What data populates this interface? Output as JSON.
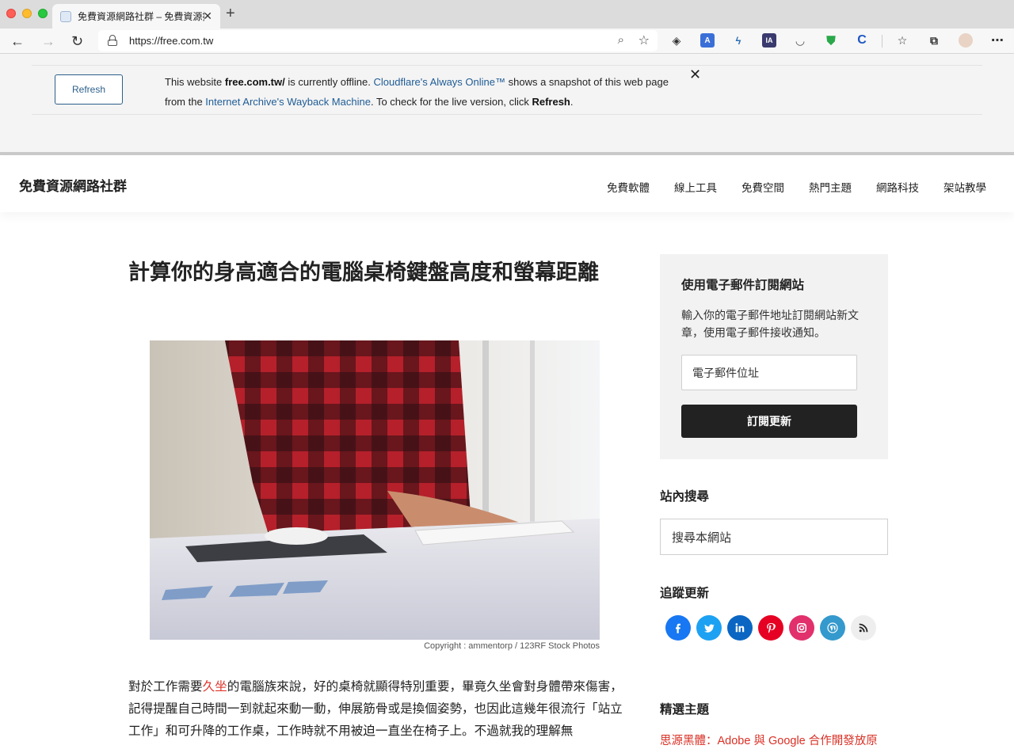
{
  "browser": {
    "tab_title": "免費資源網路社群 – 免費資源指南",
    "url": "https://free.com.tw"
  },
  "banner": {
    "refresh_label": "Refresh",
    "text_1": "This website ",
    "domain": "free.com.tw/",
    "text_2": " is currently offline. ",
    "cf_link": "Cloudflare's Always Online™",
    "text_3": " shows a snapshot of this web page from the ",
    "archive_link": "Internet Archive's Wayback Machine",
    "text_4": ". To check for the live version, click ",
    "refresh_word": "Refresh",
    "text_5": ".",
    "close_glyph": "✕"
  },
  "site": {
    "title": "免費資源網路社群",
    "nav": [
      "免費軟體",
      "線上工具",
      "免費空間",
      "熱門主題",
      "網路科技",
      "架站教學"
    ]
  },
  "article": {
    "title": "計算你的身高適合的電腦桌椅鍵盤高度和螢幕距離",
    "caption": "Copyright : ammentorp / 123RF Stock Photos",
    "body_before": "對於工作需要",
    "body_highlight": "久坐",
    "body_after": "的電腦族來說，好的桌椅就顯得特別重要，畢竟久坐會對身體帶來傷害，記得提醒自己時間一到就起來動一動，伸展筋骨或是換個姿勢，也因此這幾年很流行「站立工作」和可升降的工作桌，工作時就不用被迫一直坐在椅子上。不過就我的理解無"
  },
  "sidebar": {
    "subscribe": {
      "heading": "使用電子郵件訂閱網站",
      "desc": "輸入你的電子郵件地址訂閱網站新文章，使用電子郵件接收通知。",
      "email_placeholder": "電子郵件位址",
      "button": "訂閱更新"
    },
    "search": {
      "heading": "站內搜尋",
      "placeholder": "搜尋本網站"
    },
    "follow": {
      "heading": "追蹤更新",
      "icons": [
        "facebook-icon",
        "twitter-icon",
        "linkedin-icon",
        "pinterest-icon",
        "instagram-icon",
        "wordpress-icon",
        "rss-icon"
      ],
      "colors": [
        "#1877f2",
        "#1da1f2",
        "#0a66c2",
        "#e60023",
        "#e1306c",
        "#3499cd",
        "#eeeeee"
      ]
    },
    "featured": {
      "heading": "精選主題",
      "first_link": "思源黑體：Adobe 與 Google 合作開發放原"
    }
  }
}
